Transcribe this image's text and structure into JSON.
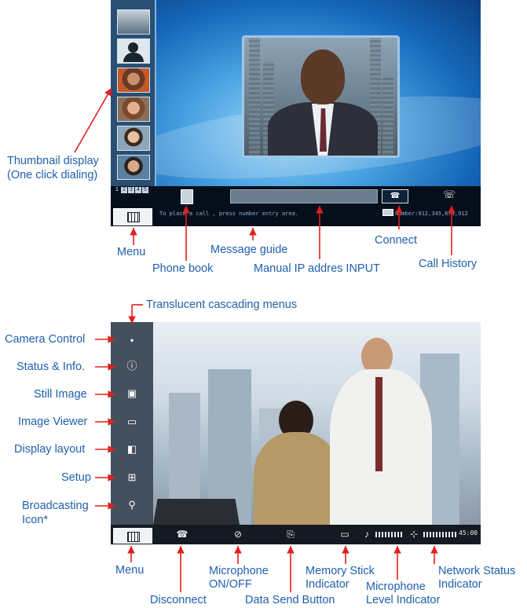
{
  "colors": {
    "label_blue": "#1f5fae",
    "callout_red": "#e0201c"
  },
  "screen_top": {
    "message_guide_text": "To place a call , press number entry area.",
    "number_readout": "Number:012,345,678,912",
    "thumbnail_pages": [
      "1",
      "2",
      "3",
      "4",
      "5"
    ],
    "icons": {
      "menu": "menu-grid-icon",
      "phone_book": "phone-book-icon",
      "connect": "handset-connect-icon",
      "call_history": "call-history-icon"
    }
  },
  "screen_bottom": {
    "network_time": "45:00",
    "side_icons": [
      "camera-icon",
      "info-icon",
      "still-image-icon",
      "image-viewer-icon",
      "display-layout-icon",
      "setup-icon",
      "broadcasting-icon"
    ],
    "bar_icons": [
      "menu-grid-icon",
      "disconnect-handset-icon",
      "microphone-muted-icon",
      "data-send-icon",
      "memory-stick-icon",
      "microphone-icon",
      "network-icon"
    ]
  },
  "labels": {
    "thumbnail_display": "Thumbnail display",
    "thumbnail_display_2": "(One click dialing)",
    "menu_top": "Menu",
    "phone_book": "Phone book",
    "message_guide": "Message guide",
    "manual_ip": "Manual IP addres INPUT",
    "connect": "Connect",
    "call_history": "Call History",
    "translucent_menus": "Translucent cascading menus",
    "camera_control": "Camera Control",
    "status_info": "Status & Info.",
    "still_image": "Still Image",
    "image_viewer": "Image Viewer",
    "display_layout": "Display layout",
    "setup": "Setup",
    "broadcasting": "Broadcasting",
    "broadcasting_2": "Icon*",
    "menu_bottom": "Menu",
    "disconnect": "Disconnect",
    "microphone_onoff": "Microphone",
    "microphone_onoff_2": "ON/OFF",
    "data_send": "Data Send Button",
    "memory_stick": "Memory Stick",
    "memory_stick_2": "Indicator",
    "mic_level": "Microphone",
    "mic_level_2": "Level Indicator",
    "network_status": "Network Status",
    "network_status_2": "Indicator"
  }
}
